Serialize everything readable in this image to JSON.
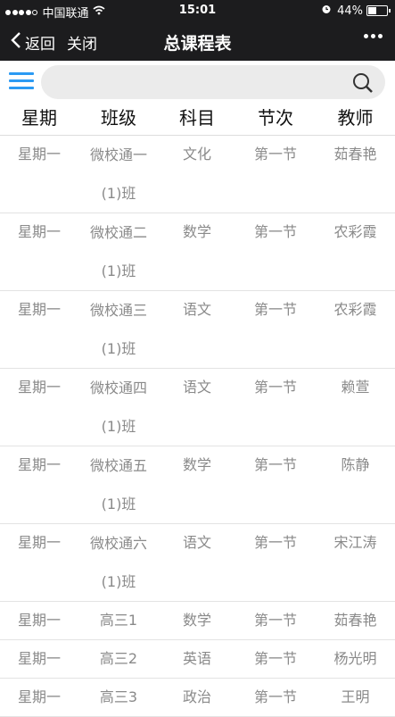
{
  "status": {
    "carrier": "中国联通",
    "time": "15:01",
    "battery": "44%",
    "battery_level": 0.44
  },
  "nav": {
    "back_label": "返回",
    "close_label": "关闭",
    "title": "总课程表"
  },
  "search": {
    "placeholder": "",
    "value": ""
  },
  "table": {
    "headers": [
      "星期",
      "班级",
      "科目",
      "节次",
      "教师"
    ],
    "rows": [
      {
        "day": "星期一",
        "class": "微校通一(1)班",
        "subject": "文化",
        "period": "第一节",
        "teacher": "茹春艳"
      },
      {
        "day": "星期一",
        "class": "微校通二(1)班",
        "subject": "数学",
        "period": "第一节",
        "teacher": "农彩霞"
      },
      {
        "day": "星期一",
        "class": "微校通三(1)班",
        "subject": "语文",
        "period": "第一节",
        "teacher": "农彩霞"
      },
      {
        "day": "星期一",
        "class": "微校通四(1)班",
        "subject": "语文",
        "period": "第一节",
        "teacher": "赖萱"
      },
      {
        "day": "星期一",
        "class": "微校通五(1)班",
        "subject": "数学",
        "period": "第一节",
        "teacher": "陈静"
      },
      {
        "day": "星期一",
        "class": "微校通六(1)班",
        "subject": "语文",
        "period": "第一节",
        "teacher": "宋江涛"
      },
      {
        "day": "星期一",
        "class": "高三1",
        "subject": "数学",
        "period": "第一节",
        "teacher": "茹春艳"
      },
      {
        "day": "星期一",
        "class": "高三2",
        "subject": "英语",
        "period": "第一节",
        "teacher": "杨光明"
      },
      {
        "day": "星期一",
        "class": "高三3",
        "subject": "政治",
        "period": "第一节",
        "teacher": "王明"
      }
    ]
  }
}
